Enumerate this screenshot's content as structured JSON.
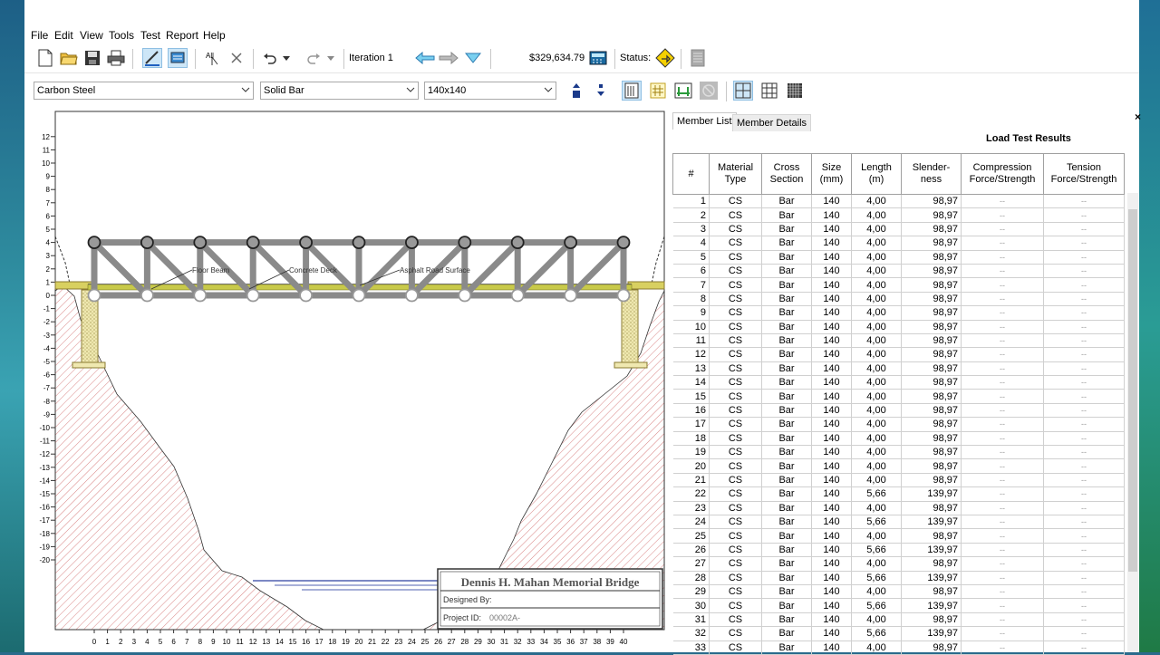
{
  "menu": [
    "File",
    "Edit",
    "View",
    "Tools",
    "Test",
    "Report",
    "Help"
  ],
  "toolbar": {
    "iteration_label": "Iteration 1",
    "cost": "$329,634.79",
    "status_label": "Status:"
  },
  "material": {
    "selected": "Carbon Steel"
  },
  "cross_section": {
    "selected": "Solid Bar"
  },
  "size": {
    "selected": "140x140"
  },
  "tabs": {
    "member_list": "Member List",
    "member_details": "Member Details"
  },
  "table": {
    "title": "Load Test Results",
    "headers": {
      "num": "#",
      "material_1": "Material",
      "material_2": "Type",
      "cross_1": "Cross",
      "cross_2": "Section",
      "size_1": "Size",
      "size_2": "(mm)",
      "length_1": "Length",
      "length_2": "(m)",
      "slender_1": "Slender-",
      "slender_2": "ness",
      "comp_1": "Compression",
      "comp_2": "Force/Strength",
      "tens_1": "Tension",
      "tens_2": "Force/Strength"
    },
    "rows": [
      [
        "1",
        "CS",
        "Bar",
        "140",
        "4,00",
        "98,97",
        "--",
        "--"
      ],
      [
        "2",
        "CS",
        "Bar",
        "140",
        "4,00",
        "98,97",
        "--",
        "--"
      ],
      [
        "3",
        "CS",
        "Bar",
        "140",
        "4,00",
        "98,97",
        "--",
        "--"
      ],
      [
        "4",
        "CS",
        "Bar",
        "140",
        "4,00",
        "98,97",
        "--",
        "--"
      ],
      [
        "5",
        "CS",
        "Bar",
        "140",
        "4,00",
        "98,97",
        "--",
        "--"
      ],
      [
        "6",
        "CS",
        "Bar",
        "140",
        "4,00",
        "98,97",
        "--",
        "--"
      ],
      [
        "7",
        "CS",
        "Bar",
        "140",
        "4,00",
        "98,97",
        "--",
        "--"
      ],
      [
        "8",
        "CS",
        "Bar",
        "140",
        "4,00",
        "98,97",
        "--",
        "--"
      ],
      [
        "9",
        "CS",
        "Bar",
        "140",
        "4,00",
        "98,97",
        "--",
        "--"
      ],
      [
        "10",
        "CS",
        "Bar",
        "140",
        "4,00",
        "98,97",
        "--",
        "--"
      ],
      [
        "11",
        "CS",
        "Bar",
        "140",
        "4,00",
        "98,97",
        "--",
        "--"
      ],
      [
        "12",
        "CS",
        "Bar",
        "140",
        "4,00",
        "98,97",
        "--",
        "--"
      ],
      [
        "13",
        "CS",
        "Bar",
        "140",
        "4,00",
        "98,97",
        "--",
        "--"
      ],
      [
        "14",
        "CS",
        "Bar",
        "140",
        "4,00",
        "98,97",
        "--",
        "--"
      ],
      [
        "15",
        "CS",
        "Bar",
        "140",
        "4,00",
        "98,97",
        "--",
        "--"
      ],
      [
        "16",
        "CS",
        "Bar",
        "140",
        "4,00",
        "98,97",
        "--",
        "--"
      ],
      [
        "17",
        "CS",
        "Bar",
        "140",
        "4,00",
        "98,97",
        "--",
        "--"
      ],
      [
        "18",
        "CS",
        "Bar",
        "140",
        "4,00",
        "98,97",
        "--",
        "--"
      ],
      [
        "19",
        "CS",
        "Bar",
        "140",
        "4,00",
        "98,97",
        "--",
        "--"
      ],
      [
        "20",
        "CS",
        "Bar",
        "140",
        "4,00",
        "98,97",
        "--",
        "--"
      ],
      [
        "21",
        "CS",
        "Bar",
        "140",
        "4,00",
        "98,97",
        "--",
        "--"
      ],
      [
        "22",
        "CS",
        "Bar",
        "140",
        "5,66",
        "139,97",
        "--",
        "--"
      ],
      [
        "23",
        "CS",
        "Bar",
        "140",
        "4,00",
        "98,97",
        "--",
        "--"
      ],
      [
        "24",
        "CS",
        "Bar",
        "140",
        "5,66",
        "139,97",
        "--",
        "--"
      ],
      [
        "25",
        "CS",
        "Bar",
        "140",
        "4,00",
        "98,97",
        "--",
        "--"
      ],
      [
        "26",
        "CS",
        "Bar",
        "140",
        "5,66",
        "139,97",
        "--",
        "--"
      ],
      [
        "27",
        "CS",
        "Bar",
        "140",
        "4,00",
        "98,97",
        "--",
        "--"
      ],
      [
        "28",
        "CS",
        "Bar",
        "140",
        "5,66",
        "139,97",
        "--",
        "--"
      ],
      [
        "29",
        "CS",
        "Bar",
        "140",
        "4,00",
        "98,97",
        "--",
        "--"
      ],
      [
        "30",
        "CS",
        "Bar",
        "140",
        "5,66",
        "139,97",
        "--",
        "--"
      ],
      [
        "31",
        "CS",
        "Bar",
        "140",
        "4,00",
        "98,97",
        "--",
        "--"
      ],
      [
        "32",
        "CS",
        "Bar",
        "140",
        "5,66",
        "139,97",
        "--",
        "--"
      ],
      [
        "33",
        "CS",
        "Bar",
        "140",
        "4,00",
        "98,97",
        "--",
        "--"
      ]
    ]
  },
  "drawing": {
    "y_ticks": [
      "12",
      "11",
      "10",
      "9",
      "8",
      "7",
      "6",
      "5",
      "4",
      "3",
      "2",
      "1",
      "0",
      "-1",
      "-2",
      "-3",
      "-4",
      "-5",
      "-6",
      "-7",
      "-8",
      "-9",
      "-10",
      "-11",
      "-12",
      "-13",
      "-14",
      "-15",
      "-16",
      "-17",
      "-18",
      "-19",
      "-20"
    ],
    "x_ticks": [
      "0",
      "1",
      "2",
      "3",
      "4",
      "5",
      "6",
      "7",
      "8",
      "9",
      "10",
      "11",
      "12",
      "13",
      "14",
      "15",
      "16",
      "17",
      "18",
      "19",
      "20",
      "21",
      "22",
      "23",
      "24",
      "25",
      "26",
      "27",
      "28",
      "29",
      "30",
      "31",
      "32",
      "33",
      "34",
      "35",
      "36",
      "37",
      "38",
      "39",
      "40"
    ],
    "labels": {
      "floor_beam": "Floor Beam",
      "concrete_deck": "Concrete Deck",
      "asphalt": "Asphalt Road Surface"
    },
    "title_block": {
      "bridge_name": "Dennis H. Mahan Memorial Bridge",
      "designed_by": "Designed By:",
      "project_id_label": "Project ID:",
      "project_id": "00002A-"
    }
  },
  "colors": {
    "truss": "#8a8a8a",
    "deck": "#c8c94a",
    "terrain_hatch": "#c04040",
    "selected_tool": "#cde6f7"
  },
  "icons": [
    "new-file-icon",
    "open-folder-icon",
    "save-icon",
    "print-icon",
    "draw-members-icon",
    "joint-tool-icon",
    "select-all-icon",
    "delete-icon",
    "undo-icon",
    "redo-icon",
    "back-arrow-icon",
    "forward-arrow-icon",
    "down-arrow-icon",
    "calculator-icon",
    "status-warning-icon",
    "report-icon",
    "increase-size-icon",
    "decrease-size-icon",
    "member-list-icon",
    "grid-numbers-icon",
    "member-properties-icon",
    "disabled-icon",
    "grid-coarse-icon",
    "grid-medium-icon",
    "grid-fine-icon"
  ]
}
